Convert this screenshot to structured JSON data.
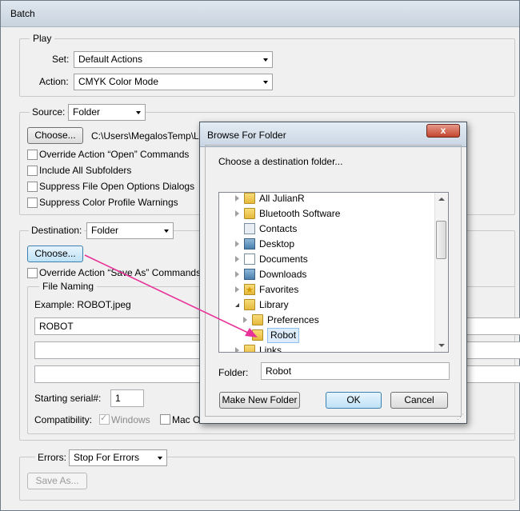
{
  "batch": {
    "title": "Batch",
    "play": {
      "legend": "Play",
      "set_label": "Set:",
      "set_value": "Default Actions",
      "action_label": "Action:",
      "action_value": "CMYK Color Mode"
    },
    "source": {
      "label": "Source:",
      "value": "Folder",
      "choose_button": "Choose...",
      "path": "C:\\Users\\MegalosTemp\\L",
      "checkboxes": [
        "Override Action “Open” Commands",
        "Include All Subfolders",
        "Suppress File Open Options Dialogs",
        "Suppress Color Profile Warnings"
      ]
    },
    "destination": {
      "label": "Destination:",
      "value": "Folder",
      "choose_button": "Choose...",
      "override_save_as": "Override Action “Save As” Commands",
      "file_naming": {
        "legend": "File Naming",
        "example": "Example: ROBOT.jpeg",
        "field1": "ROBOT",
        "field2": "",
        "field3": "",
        "serial_label": "Starting serial#:",
        "serial_value": "1",
        "compatibility_label": "Compatibility:",
        "windows_label": "Windows",
        "mac_label": "Mac O"
      }
    },
    "errors": {
      "label": "Errors:",
      "value": "Stop For Errors",
      "save_as_button": "Save As..."
    }
  },
  "browse_dialog": {
    "title": "Browse For Folder",
    "close_glyph": "x",
    "prompt": "Choose a destination folder...",
    "tree": [
      {
        "label": "All JulianR",
        "icon": "folder-icon",
        "state": "collapsed",
        "level": 0
      },
      {
        "label": "Bluetooth Software",
        "icon": "folder-icon",
        "state": "collapsed",
        "level": 0
      },
      {
        "label": "Contacts",
        "icon": "contacts-icon",
        "state": "none",
        "level": 0
      },
      {
        "label": "Desktop",
        "icon": "desktop-icon",
        "state": "collapsed",
        "level": 0
      },
      {
        "label": "Documents",
        "icon": "documents-icon",
        "state": "collapsed",
        "level": 0
      },
      {
        "label": "Downloads",
        "icon": "downloads-icon",
        "state": "collapsed",
        "level": 0
      },
      {
        "label": "Favorites",
        "icon": "favorites-icon",
        "state": "collapsed",
        "level": 0
      },
      {
        "label": "Library",
        "icon": "folder-icon",
        "state": "expanded",
        "level": 0
      },
      {
        "label": "Preferences",
        "icon": "folder-icon",
        "state": "collapsed",
        "level": 1
      },
      {
        "label": "Robot",
        "icon": "folder-icon",
        "state": "none",
        "level": 1,
        "selected": true
      },
      {
        "label": "Links",
        "icon": "folder-icon",
        "state": "collapsed",
        "level": 0
      }
    ],
    "folder_label": "Folder:",
    "folder_value": "Robot",
    "make_new_folder_button": "Make New Folder",
    "ok_button": "OK",
    "cancel_button": "Cancel"
  },
  "annotation": {
    "arrow_color": "#e8329a"
  }
}
